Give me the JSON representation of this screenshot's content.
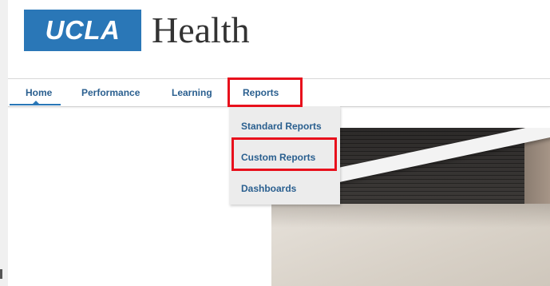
{
  "brand": {
    "logo_mark": "UCLA",
    "logo_word": "Health",
    "accent_color": "#2a77b7"
  },
  "nav": {
    "items": [
      {
        "label": "Home",
        "active": true
      },
      {
        "label": "Performance"
      },
      {
        "label": "Learning"
      },
      {
        "label": "Reports",
        "highlighted": true
      }
    ]
  },
  "reports_menu": {
    "items": [
      {
        "label": "Standard Reports"
      },
      {
        "label": "Custom Reports",
        "highlighted": true
      },
      {
        "label": "Dashboards"
      }
    ]
  },
  "highlight_color": "#e8101c"
}
